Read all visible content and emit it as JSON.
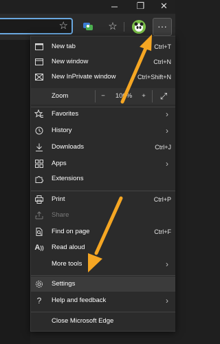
{
  "window": {
    "restore_glyph": "❐",
    "close_glyph": "✕"
  },
  "toolbar": {
    "favorite_glyph": "☆",
    "collections_glyph": "⛉",
    "favorites_list_glyph": "☆",
    "more_glyph": "···"
  },
  "menu": {
    "items_top": [
      {
        "label": "New tab",
        "shortcut": "Ctrl+T",
        "icon": "new-tab-icon"
      },
      {
        "label": "New window",
        "shortcut": "Ctrl+N",
        "icon": "new-window-icon"
      },
      {
        "label": "New InPrivate window",
        "shortcut": "Ctrl+Shift+N",
        "icon": "inprivate-icon"
      }
    ],
    "zoom": {
      "label": "Zoom",
      "minus": "−",
      "value": "100%",
      "plus": "+",
      "fullscreen": "⤢"
    },
    "items_mid": [
      {
        "label": "Favorites",
        "icon": "favorites-icon"
      },
      {
        "label": "History",
        "icon": "history-icon"
      },
      {
        "label": "Downloads",
        "shortcut": "Ctrl+J",
        "icon": "downloads-icon"
      },
      {
        "label": "Apps",
        "icon": "apps-icon"
      },
      {
        "label": "Extensions",
        "icon": "extensions-icon"
      }
    ],
    "items_tools": [
      {
        "label": "Print",
        "shortcut": "Ctrl+P",
        "icon": "print-icon"
      },
      {
        "label": "Share",
        "icon": "share-icon"
      },
      {
        "label": "Find on page",
        "shortcut": "Ctrl+F",
        "icon": "find-icon"
      },
      {
        "label": "Read aloud",
        "icon": "read-aloud-icon"
      },
      {
        "label": "More tools",
        "icon": "more-tools-icon"
      }
    ],
    "items_bottom": [
      {
        "label": "Settings",
        "icon": "settings-icon"
      },
      {
        "label": "Help and feedback",
        "icon": "help-icon"
      }
    ],
    "close_label": "Close Microsoft Edge"
  },
  "colors": {
    "menu_bg": "#2b2b2b",
    "arrow": "#f5a623",
    "address_border": "#6aa8e0"
  }
}
